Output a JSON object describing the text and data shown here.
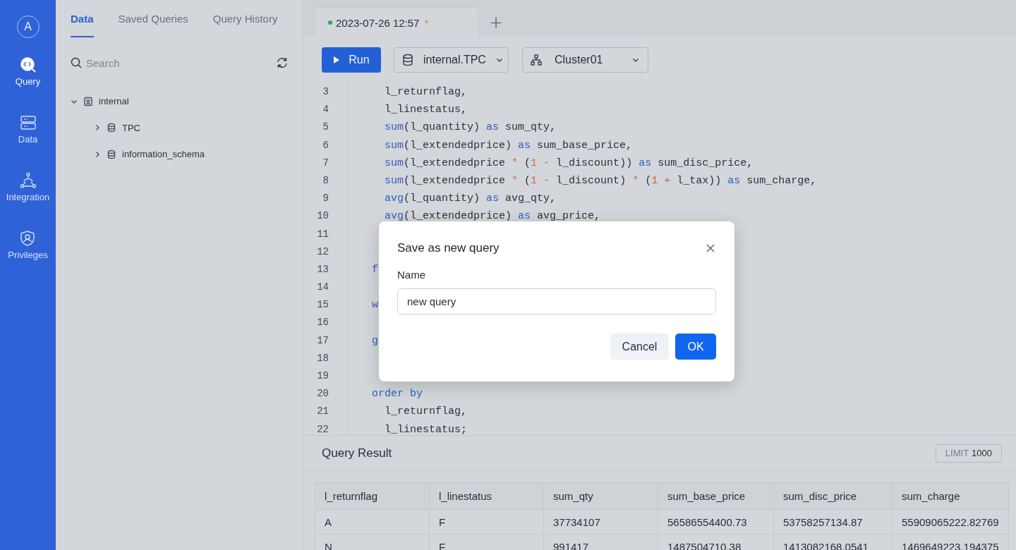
{
  "nav": {
    "avatar": "A",
    "items": [
      {
        "label": "Query",
        "kind": "query",
        "selected": true
      },
      {
        "label": "Data",
        "kind": "data",
        "selected": false
      },
      {
        "label": "Integration",
        "kind": "integration",
        "selected": false
      },
      {
        "label": "Privileges",
        "kind": "privileges",
        "selected": false
      }
    ]
  },
  "panel": {
    "tabs": [
      {
        "label": "Data",
        "selected": true
      },
      {
        "label": "Saved Queries",
        "selected": false
      },
      {
        "label": "Query History",
        "selected": false
      }
    ],
    "search": {
      "placeholder": "Search"
    },
    "tree": [
      {
        "label": "internal",
        "kind": "catalog",
        "expanded": true,
        "children": [
          {
            "label": "TPC",
            "kind": "database",
            "expanded": false
          },
          {
            "label": "information_schema",
            "kind": "database",
            "expanded": false
          }
        ]
      }
    ]
  },
  "editor": {
    "tabs": [
      {
        "label": "2023-07-26 12:57",
        "modified": "*",
        "selected": true
      }
    ],
    "add": "+",
    "run": "Run",
    "database": "internal.TPC",
    "cluster": "Cluster01",
    "lines": [
      {
        "number": "3",
        "tokens": [
          {
            "kind": "text",
            "text": "    l_returnflag,"
          }
        ]
      },
      {
        "number": "4",
        "tokens": [
          {
            "kind": "text",
            "text": "    l_linestatus,"
          }
        ]
      },
      {
        "number": "5",
        "tokens": [
          {
            "kind": "kw",
            "text": "    sum"
          },
          {
            "kind": "text",
            "text": "(l_quantity) "
          },
          {
            "kind": "kw",
            "text": "as"
          },
          {
            "kind": "text",
            "text": " sum_qty,"
          }
        ]
      },
      {
        "number": "6",
        "tokens": [
          {
            "kind": "kw",
            "text": "    sum"
          },
          {
            "kind": "text",
            "text": "(l_extendedprice) "
          },
          {
            "kind": "kw",
            "text": "as"
          },
          {
            "kind": "text",
            "text": " sum_base_price,"
          }
        ]
      },
      {
        "number": "7",
        "tokens": [
          {
            "kind": "kw",
            "text": "    sum"
          },
          {
            "kind": "text",
            "text": "(l_extendedprice "
          },
          {
            "kind": "op",
            "text": "*"
          },
          {
            "kind": "text",
            "text": " ("
          },
          {
            "kind": "num",
            "text": "1"
          },
          {
            "kind": "op",
            "text": " -"
          },
          {
            "kind": "text",
            "text": " l_discount)) "
          },
          {
            "kind": "kw",
            "text": "as"
          },
          {
            "kind": "text",
            "text": " sum_disc_price,"
          }
        ]
      },
      {
        "number": "8",
        "tokens": [
          {
            "kind": "kw",
            "text": "    sum"
          },
          {
            "kind": "text",
            "text": "(l_extendedprice "
          },
          {
            "kind": "op",
            "text": "*"
          },
          {
            "kind": "text",
            "text": " ("
          },
          {
            "kind": "num",
            "text": "1"
          },
          {
            "kind": "op",
            "text": " -"
          },
          {
            "kind": "text",
            "text": " l_discount) "
          },
          {
            "kind": "op",
            "text": "*"
          },
          {
            "kind": "text",
            "text": " ("
          },
          {
            "kind": "num",
            "text": "1"
          },
          {
            "kind": "op",
            "text": " +"
          },
          {
            "kind": "text",
            "text": " l_tax)) "
          },
          {
            "kind": "kw",
            "text": "as"
          },
          {
            "kind": "text",
            "text": " sum_charge,"
          }
        ]
      },
      {
        "number": "9",
        "tokens": [
          {
            "kind": "kw",
            "text": "    avg"
          },
          {
            "kind": "text",
            "text": "(l_quantity) "
          },
          {
            "kind": "kw",
            "text": "as"
          },
          {
            "kind": "text",
            "text": " avg_qty,"
          }
        ]
      },
      {
        "number": "10",
        "tokens": [
          {
            "kind": "kw",
            "text": "    avg"
          },
          {
            "kind": "text",
            "text": "(l_extendedprice) "
          },
          {
            "kind": "kw",
            "text": "as"
          },
          {
            "kind": "text",
            "text": " avg_price,"
          }
        ]
      },
      {
        "number": "11"
      },
      {
        "number": "12"
      },
      {
        "number": "13",
        "tokens": [
          {
            "kind": "kw",
            "text": "  f"
          }
        ]
      },
      {
        "number": "14"
      },
      {
        "number": "15",
        "tokens": [
          {
            "kind": "kw",
            "text": "  w"
          }
        ]
      },
      {
        "number": "16"
      },
      {
        "number": "17",
        "tokens": [
          {
            "kind": "kw",
            "text": "  g"
          }
        ]
      },
      {
        "number": "18"
      },
      {
        "number": "19"
      },
      {
        "number": "20",
        "tokens": [
          {
            "kind": "kw",
            "text": "  order by"
          }
        ]
      },
      {
        "number": "21",
        "tokens": [
          {
            "kind": "text",
            "text": "    l_returnflag,"
          }
        ]
      },
      {
        "number": "22",
        "tokens": [
          {
            "kind": "text",
            "text": "    l_linestatus;"
          }
        ]
      }
    ]
  },
  "result": {
    "title": "Query Result",
    "limit_label": "LIMIT",
    "limit_value": "1000",
    "columns": [
      "l_returnflag",
      "l_linestatus",
      "sum_qty",
      "sum_base_price",
      "sum_disc_price",
      "sum_charge"
    ],
    "rows": [
      [
        "A",
        "F",
        "37734107",
        "56586554400.73",
        "53758257134.87",
        "55909065222.82769"
      ],
      [
        "N",
        "F",
        "991417",
        "1487504710.38",
        "1413082168.0541",
        "1469649223.194375"
      ]
    ]
  },
  "dialog": {
    "title": "Save as new query",
    "field_label": "Name",
    "value": "new query",
    "cancel": "Cancel",
    "ok": "OK"
  }
}
